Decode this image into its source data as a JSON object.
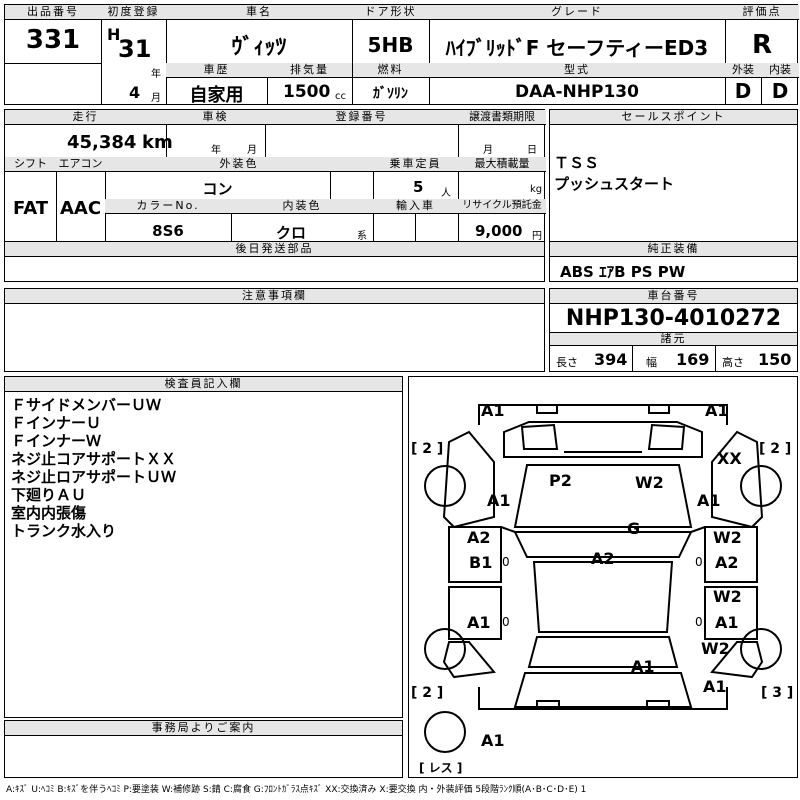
{
  "header": {
    "lot_no_label": "出品番号",
    "lot_no": "331",
    "first_reg_label": "初度登録",
    "era": "H",
    "year": "31",
    "year_unit": "年",
    "month": "4",
    "month_unit": "月",
    "car_name_label": "車名",
    "car_name": "ｳﾞｨｯﾂ",
    "door_label": "ドア形状",
    "door": "5HB",
    "grade_label": "グレード",
    "grade": "ﾊｲﾌﾞﾘｯﾄﾞF セーフティーED3",
    "score_label": "評価点",
    "score": "R",
    "history_label": "車歴",
    "history": "自家用",
    "displacement_label": "排気量",
    "displacement": "1500",
    "displacement_unit": "cc",
    "fuel_label": "燃料",
    "fuel": "ｶﾞｿﾘﾝ",
    "model_label": "型式",
    "model": "DAA-NHP130",
    "exterior_label": "外装",
    "exterior": "D",
    "interior_label": "内装",
    "interior": "D"
  },
  "specs": {
    "mileage_label": "走行",
    "mileage": "45,384",
    "mileage_unit": "km",
    "inspection_label": "車検",
    "inspection_year_unit": "年",
    "inspection_month_unit": "月",
    "reg_no_label": "登録番号",
    "transfer_label": "譲渡書類期限",
    "transfer_month_unit": "月",
    "transfer_day_unit": "日",
    "shift_label": "シフト",
    "shift": "FAT",
    "ac_label": "エアコン",
    "ac": "AAC",
    "ext_color_label": "外装色",
    "ext_color": "コン",
    "capacity_label": "乗車定員",
    "capacity": "5",
    "capacity_unit": "人",
    "max_load_label": "最大積載量",
    "max_load_unit": "kg",
    "color_no_label": "カラーNo.",
    "color_no": "8S6",
    "int_color_label": "内装色",
    "int_color": "クロ",
    "int_color_unit": "系",
    "import_label": "輸入車",
    "recycle_label": "リサイクル預託金",
    "recycle": "9,000",
    "recycle_unit": "円",
    "later_parts_label": "後日発送部品"
  },
  "sales_points": {
    "label": "セールスポイント",
    "items": [
      "ＴＳＳ",
      "プッシュスタート"
    ]
  },
  "equipment": {
    "label": "純正装備",
    "value": "ABS ｴｱB PS PW"
  },
  "notes": {
    "label": "注意事項欄"
  },
  "chassis": {
    "label": "車台番号",
    "value": "NHP130-4010272",
    "dims_label": "諸元",
    "length_label": "長さ",
    "length": "394",
    "width_label": "幅",
    "width": "169",
    "height_label": "高さ",
    "height": "150"
  },
  "inspector": {
    "label": "検査員記入欄",
    "lines": [
      "ＦサイドメンバーＵＷ",
      "ＦインナーＵ",
      "ＦインナーＷ",
      "ネジ止コアサポートＸＸ",
      "ネジ止ロアサポートＵＷ",
      "下廻りＡＵ",
      "室内内張傷",
      "トランク水入り"
    ]
  },
  "office": {
    "label": "事務局よりご案内"
  },
  "diagram": {
    "marks": {
      "front_left": "A1",
      "front_right": "A1",
      "xx": "XX",
      "fl_fender": "A1",
      "fr_fender": "A1",
      "p2": "P2",
      "w2_hood": "W2",
      "g": "G",
      "a2_left": "A2",
      "b1_left": "B1",
      "a2_roof": "A2",
      "w2_r1": "W2",
      "a2_right": "A2",
      "w2_r2": "W2",
      "a1_right": "A1",
      "a1_left_rear": "A1",
      "w2_r3": "W2",
      "a1_trunk": "A1",
      "a1_rr": "A1",
      "a1_rear": "A1"
    },
    "zero": "0",
    "tire_fl": "[ 2 ]",
    "tire_fr": "[ 2 ]",
    "tire_rl": "[ 2 ]",
    "tire_rr": "[ 3 ]",
    "spare": "[ レス ]"
  },
  "legend": "A:ｷｽﾞ U:ﾍｺﾐ B:ｷｽﾞを伴うﾍｺﾐ P:要塗装 W:補修跡 S:錆 C:腐食 G:ﾌﾛﾝﾄｶﾞﾗｽ点ｷｽﾞ XX:交換済み X:要交換 内・外装評価 5段階ﾗﾝｸ順(A･B･C･D･E) 1"
}
